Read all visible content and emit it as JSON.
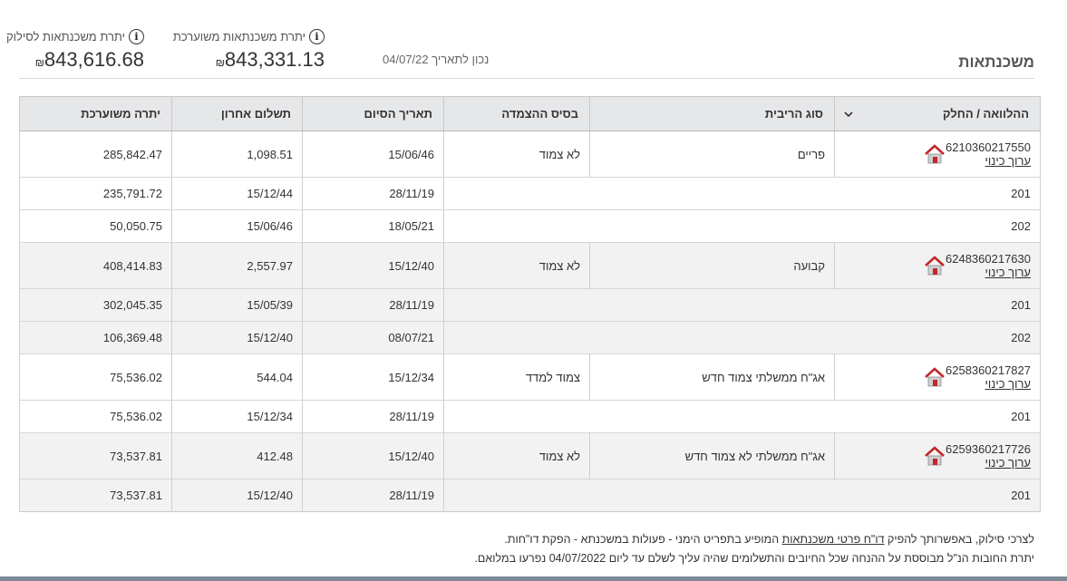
{
  "header": {
    "title": "משכנתאות",
    "as_of": "נכון לתאריך 04/07/22",
    "balance_estimated_label": "יתרת משכנתאות משוערכת",
    "balance_estimated_value": "843,331.13",
    "balance_payoff_label": "יתרת משכנתאות לסילוק",
    "balance_payoff_value": "843,616.68",
    "currency": "₪",
    "info_glyph": "i"
  },
  "table": {
    "columns": [
      "ההלוואה / החלק",
      "סוג הריבית",
      "בסיס ההצמדה",
      "תאריך הסיום",
      "תשלום אחרון",
      "יתרה משוערכת"
    ],
    "loans": [
      {
        "number": "6210360217550",
        "alias": "ערוך כינוי",
        "interest_type": "פריים",
        "index_base": "לא צמוד",
        "end_date": "15/06/46",
        "last_payment": "1,098.51",
        "balance": "285,842.47",
        "parts": [
          {
            "id": "201",
            "end_date": "28/11/19",
            "last_payment": "15/12/44",
            "balance": "235,791.72"
          },
          {
            "id": "202",
            "end_date": "18/05/21",
            "last_payment": "15/06/46",
            "balance": "50,050.75"
          }
        ]
      },
      {
        "number": "6248360217630",
        "alias": "ערוך כינוי",
        "interest_type": "קבועה",
        "index_base": "לא צמוד",
        "end_date": "15/12/40",
        "last_payment": "2,557.97",
        "balance": "408,414.83",
        "parts": [
          {
            "id": "201",
            "end_date": "28/11/19",
            "last_payment": "15/05/39",
            "balance": "302,045.35"
          },
          {
            "id": "202",
            "end_date": "08/07/21",
            "last_payment": "15/12/40",
            "balance": "106,369.48"
          }
        ]
      },
      {
        "number": "6258360217827",
        "alias": "ערוך כינוי",
        "interest_type": "אג\"ח ממשלתי צמוד חדש",
        "index_base": "צמוד למדד",
        "end_date": "15/12/34",
        "last_payment": "544.04",
        "balance": "75,536.02",
        "parts": [
          {
            "id": "201",
            "end_date": "28/11/19",
            "last_payment": "15/12/34",
            "balance": "75,536.02"
          }
        ]
      },
      {
        "number": "6259360217726",
        "alias": "ערוך כינוי",
        "interest_type": "אג\"ח ממשלתי לא צמוד חדש",
        "index_base": "לא צמוד",
        "end_date": "15/12/40",
        "last_payment": "412.48",
        "balance": "73,537.81",
        "parts": [
          {
            "id": "201",
            "end_date": "28/11/19",
            "last_payment": "15/12/40",
            "balance": "73,537.81"
          }
        ]
      }
    ]
  },
  "footer": {
    "line1_prefix": "לצרכי סילוק, באפשרותך להפיק ",
    "line1_link": "דו\"ח פרטי משכנתאות",
    "line1_suffix": " המופיע בתפריט הימני - פעולות במשכנתא - הפקת דו\"חות.",
    "line2": "יתרת החובות הנ\"ל מבוססת על ההנחה שכל החיובים והתשלומים שהיה עליך לשלם עד ליום 04/07/2022 נפרעו במלואם."
  },
  "colors": {
    "house_roof": "#c0282b",
    "house_body": "#cfcfcf",
    "header_bg": "#e6e7e9",
    "alt_row_bg": "#f2f2f2"
  },
  "icons": {
    "info": "info-icon",
    "house": "house-icon",
    "sort": "chevron-down-icon"
  }
}
